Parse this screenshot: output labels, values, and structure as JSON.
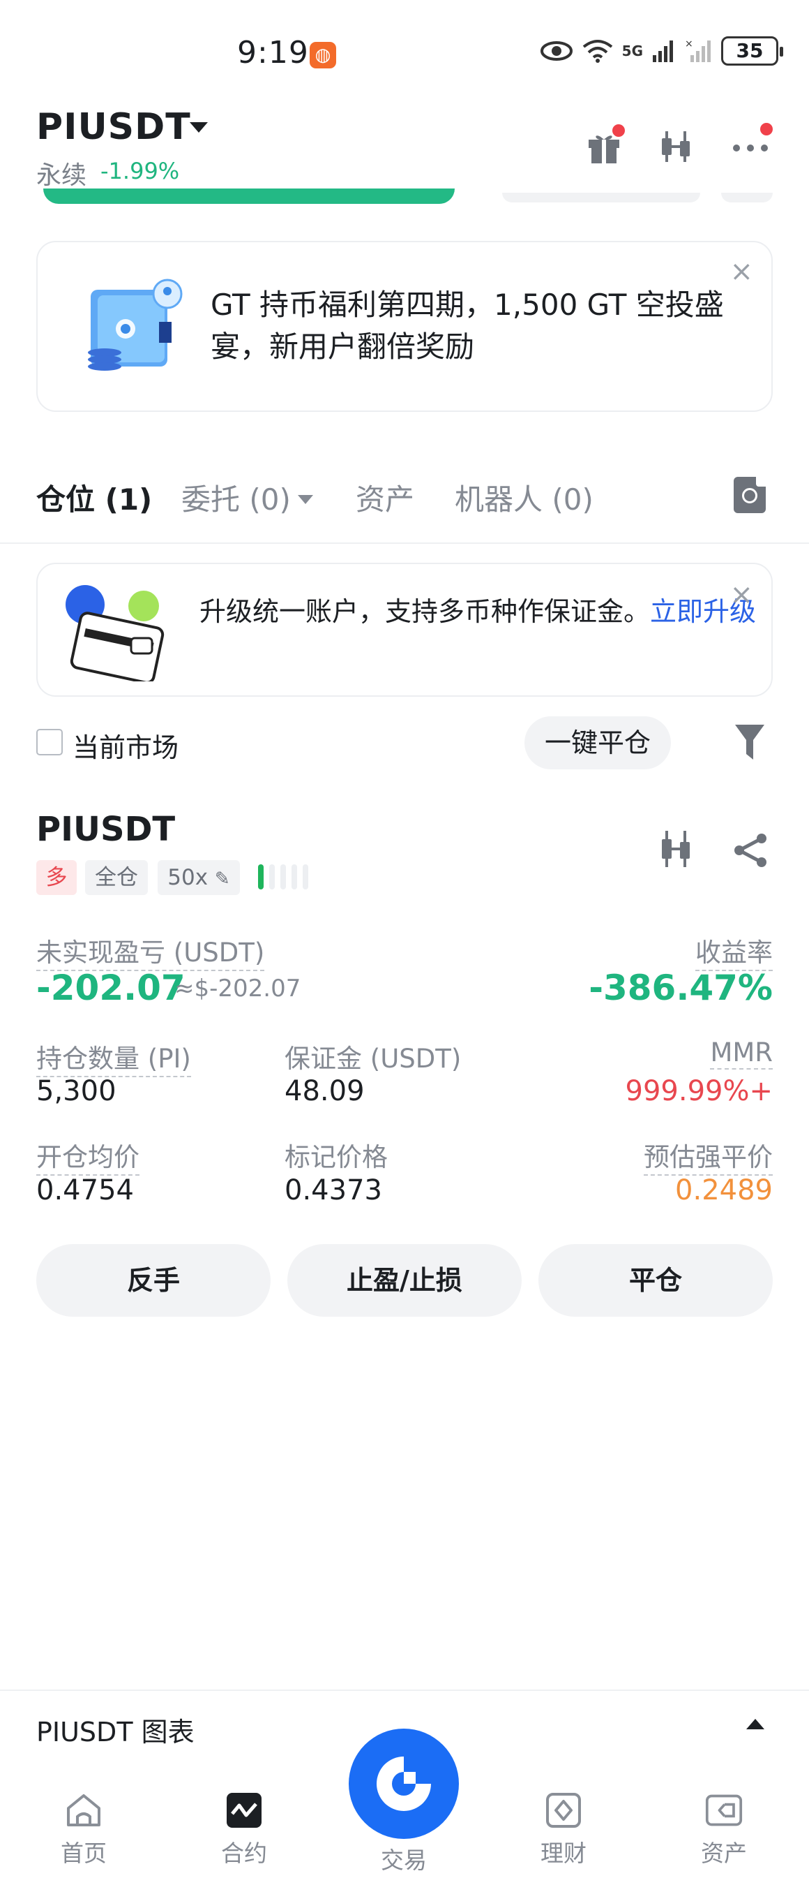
{
  "status_bar": {
    "time": "9:19",
    "battery": "35",
    "signal_text": "5G"
  },
  "header": {
    "pair": "PIUSDT",
    "type": "永续",
    "change": "-1.99%"
  },
  "banner_top": {
    "text": "GT 持币福利第四期，1,500 GT 空投盛宴，新用户翻倍奖励",
    "close": "×"
  },
  "tabs": [
    {
      "label": "仓位 (1)"
    },
    {
      "label": "委托 (0)"
    },
    {
      "label": "资产"
    },
    {
      "label": "机器人 (0)"
    }
  ],
  "banner_upgrade": {
    "text": "升级统一账户，支持多币种作保证金。",
    "link": "立即升级",
    "close": "×"
  },
  "filter": {
    "current_market": "当前市场",
    "close_all": "一键平仓"
  },
  "position": {
    "symbol": "PIUSDT",
    "side": "多",
    "margin_mode": "全仓",
    "leverage": "50x",
    "unrealized_label": "未实现盈亏 (USDT)",
    "unrealized_value": "-202.07",
    "unrealized_usd": "≈$-202.07",
    "roe_label": "收益率",
    "roe_value": "-386.47%",
    "qty_label": "持仓数量 (PI)",
    "qty_value": "5,300",
    "margin_label": "保证金 (USDT)",
    "margin_value": "48.09",
    "mmr_label": "MMR",
    "mmr_value": "999.99%+",
    "entry_label": "开仓均价",
    "entry_value": "0.4754",
    "mark_label": "标记价格",
    "mark_value": "0.4373",
    "liq_label": "预估强平价",
    "liq_value": "0.2489"
  },
  "actions": {
    "reverse": "反手",
    "tpsl": "止盈/止损",
    "close": "平仓"
  },
  "chart_bar": {
    "label": "PIUSDT 图表"
  },
  "bottom_nav": [
    {
      "label": "首页"
    },
    {
      "label": "合约"
    },
    {
      "label": "交易"
    },
    {
      "label": "理财"
    },
    {
      "label": "资产"
    }
  ],
  "colors": {
    "green": "#1fb57f",
    "red": "#e8474f",
    "orange": "#f2913c",
    "blue": "#1b6df5"
  }
}
